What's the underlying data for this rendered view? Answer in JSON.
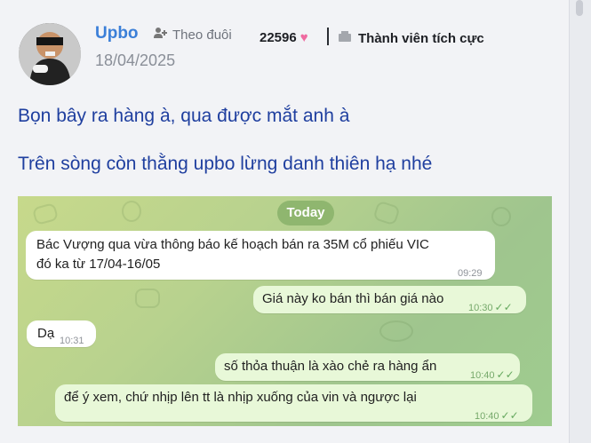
{
  "post": {
    "username": "Upbo",
    "follow_label": "Theo đuôi",
    "points": "22596",
    "rank_label": "Thành viên tích cực",
    "date": "18/04/2025",
    "lines": [
      "Bọn bây ra hàng à, qua được mắt anh à",
      "Trên sòng còn thằng upbo lừng danh thiên hạ nhé"
    ]
  },
  "screenshot": {
    "date_chip": "Today",
    "messages": [
      {
        "text_line_1": "Bác Vượng qua vừa thông báo kế hoạch bán ra 35M cổ phiếu VIC",
        "text_line_2": "đó ka từ 17/04-16/05",
        "time": "09:29"
      },
      {
        "text": "Giá này ko bán thì bán giá nào",
        "time": "10:30"
      },
      {
        "text": "Dạ",
        "time": "10:31"
      },
      {
        "text": "số thỏa thuận là xào chẻ ra hàng ẩn",
        "time": "10:40"
      },
      {
        "text": "để ý xem, chứ nhịp lên tt là nhịp xuống của vin và ngược lại",
        "time": "10:40"
      }
    ]
  },
  "icons": {
    "follow": "user-plus-icon",
    "heart": "heart-icon",
    "rank": "badge-icon",
    "read": "double-check-icon"
  },
  "colors": {
    "username": "#3b7fd8",
    "post_text": "#1f3f9f",
    "heart": "#ef6aa0",
    "chat_background": "#b8d28e",
    "outgoing_bubble": "#e8f8d8"
  }
}
